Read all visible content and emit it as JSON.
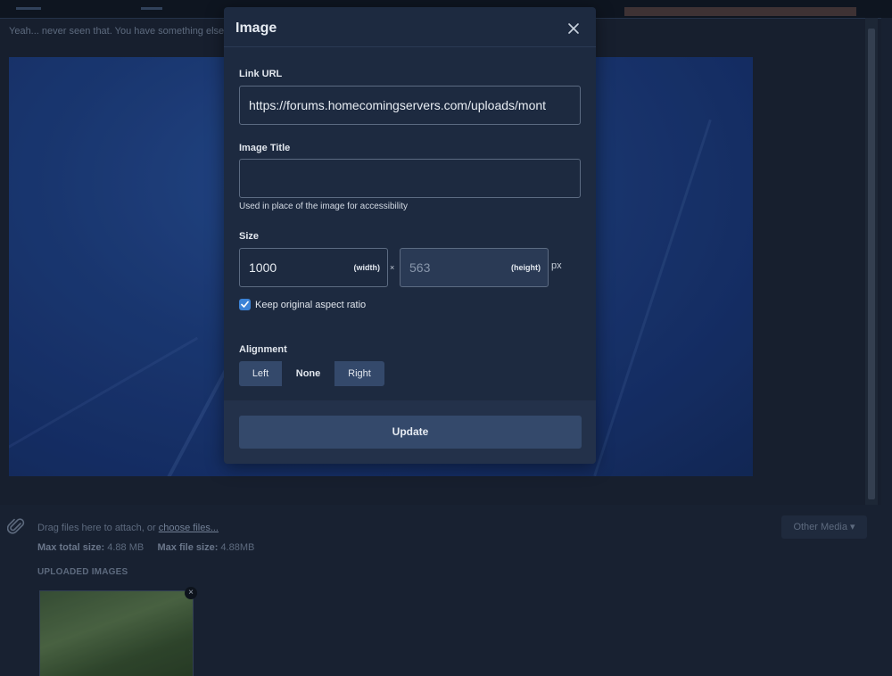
{
  "background": {
    "editor_text": "Yeah... never seen that.  You have something else",
    "attach_prefix": "Drag files here to attach, or ",
    "attach_link": "choose files...",
    "max_total_label": "Max total size:",
    "max_total_value": "4.88 MB",
    "max_file_label": "Max file size:",
    "max_file_value": "4.88MB",
    "uploaded_title": "UPLOADED IMAGES",
    "other_media": "Other Media ▾",
    "thumb_close": "×"
  },
  "modal": {
    "title": "Image",
    "link_url_label": "Link URL",
    "link_url_value": "https://forums.homecomingservers.com/uploads/mont",
    "image_title_label": "Image Title",
    "image_title_value": "",
    "image_title_helper": "Used in place of the image for accessibility",
    "size_label": "Size",
    "width_value": "1000",
    "width_suffix": "(width)",
    "times": "×",
    "height_value": "563",
    "height_suffix": "(height)",
    "px": "px",
    "keep_ratio_label": "Keep original aspect ratio",
    "keep_ratio_checked": true,
    "alignment_label": "Alignment",
    "align_left": "Left",
    "align_none": "None",
    "align_right": "Right",
    "update_label": "Update"
  },
  "colors": {
    "modal_bg": "#1d2a40",
    "button_bg": "#34496b",
    "checkbox_accent": "#3b82d6"
  }
}
